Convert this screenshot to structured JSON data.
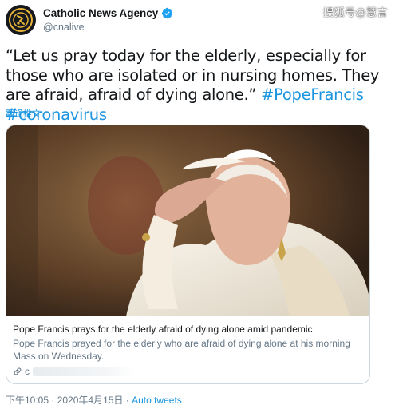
{
  "watermark": "搜狐号@慧言",
  "account": {
    "display_name": "Catholic News Agency",
    "handle": "@cnalive"
  },
  "tweet": {
    "text_main": "“Let us pray today for the elderly, especially for those who are isolated or in nursing homes. They are afraid, afraid of dying alone.” ",
    "hashtag_1": "#PopeFrancis",
    "hashtag_2": "#coronavirus",
    "translate_label": "翻译推文"
  },
  "card": {
    "title": "Pope Francis prays for the elderly afraid of dying alone amid pandemic",
    "description": "Pope Francis prayed for the elderly who are afraid of dying alone at his morning Mass on Wednesday.",
    "link_prefix": "c"
  },
  "footer": {
    "timestamp": "下午10:05 · 2020年4月15日 · ",
    "source": "Auto tweets"
  },
  "colors": {
    "link": "#1b95e0",
    "verified": "#1da1f2",
    "secondary_text": "#657786"
  }
}
